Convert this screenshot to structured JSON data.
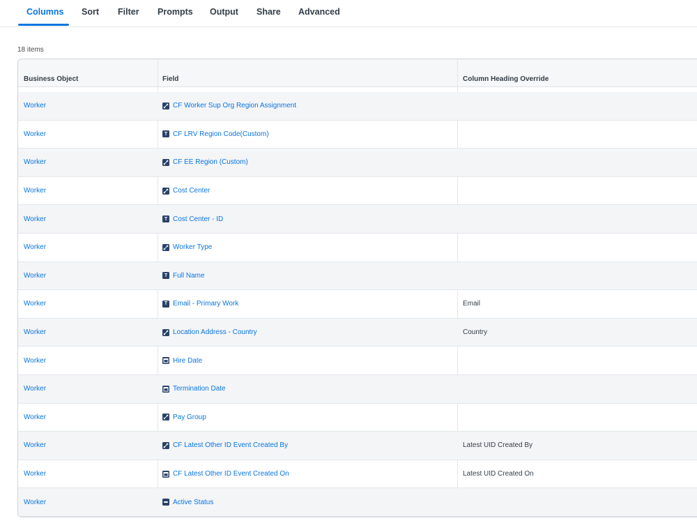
{
  "tabs": [
    {
      "label": "Columns",
      "active": true
    },
    {
      "label": "Sort"
    },
    {
      "label": "Filter"
    },
    {
      "label": "Prompts"
    },
    {
      "label": "Output"
    },
    {
      "label": "Share"
    },
    {
      "label": "Advanced"
    }
  ],
  "item_count": "18 items",
  "table": {
    "headers": [
      "Business Object",
      "Field",
      "Column Heading Override"
    ],
    "rows": [
      {
        "business_object": "Worker",
        "field": "CF Worker Sup Org Region Assignment",
        "icon": "instance-icon",
        "override": ""
      },
      {
        "business_object": "Worker",
        "field": "CF LRV Region Code(Custom)",
        "icon": "text-icon",
        "override": ""
      },
      {
        "business_object": "Worker",
        "field": "CF EE Region (Custom)",
        "icon": "instance-icon",
        "override": ""
      },
      {
        "business_object": "Worker",
        "field": "Cost Center",
        "icon": "instance-icon",
        "override": ""
      },
      {
        "business_object": "Worker",
        "field": "Cost Center - ID",
        "icon": "text-icon",
        "override": ""
      },
      {
        "business_object": "Worker",
        "field": "Worker Type",
        "icon": "instance-icon",
        "override": ""
      },
      {
        "business_object": "Worker",
        "field": "Full Name",
        "icon": "text-icon",
        "override": ""
      },
      {
        "business_object": "Worker",
        "field": "Email - Primary Work",
        "icon": "text-icon",
        "override": "Email"
      },
      {
        "business_object": "Worker",
        "field": "Location Address - Country",
        "icon": "instance-icon",
        "override": "Country"
      },
      {
        "business_object": "Worker",
        "field": "Hire Date",
        "icon": "date-icon",
        "override": ""
      },
      {
        "business_object": "Worker",
        "field": "Termination Date",
        "icon": "date-icon",
        "override": ""
      },
      {
        "business_object": "Worker",
        "field": "Pay Group",
        "icon": "instance-icon",
        "override": ""
      },
      {
        "business_object": "Worker",
        "field": "CF Latest Other ID Event Created By",
        "icon": "instance-icon",
        "override": "Latest UID Created By"
      },
      {
        "business_object": "Worker",
        "field": "CF Latest Other ID Event Created On",
        "icon": "date-icon",
        "override": "Latest UID Created On"
      },
      {
        "business_object": "Worker",
        "field": "Active Status",
        "icon": "boolean-icon",
        "override": ""
      }
    ]
  },
  "colors": {
    "accent": "#0875e1",
    "icon_bg": "#294269"
  }
}
